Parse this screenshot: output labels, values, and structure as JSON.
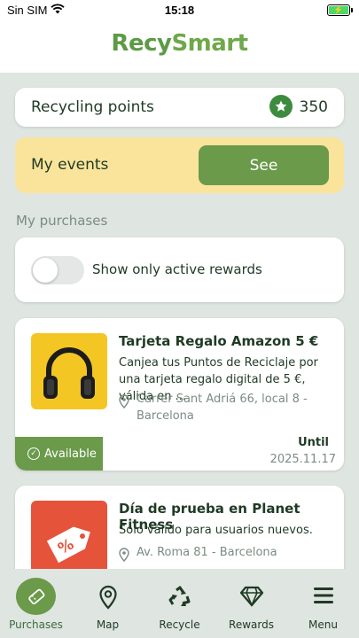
{
  "status_bar": {
    "carrier": "Sin SIM",
    "time": "15:18",
    "battery_level": 1.0
  },
  "header": {
    "logo_part1": "Recy",
    "logo_part2": "Smart"
  },
  "points": {
    "label": "Recycling points",
    "value": "350",
    "icon": "star-icon"
  },
  "events": {
    "label": "My events",
    "button_label": "See"
  },
  "purchases": {
    "section_title": "My purchases",
    "filter_label": "Show only active rewards",
    "filter_on": false,
    "items": [
      {
        "title": "Tarjeta Regalo Amazon 5 €",
        "description": "Canjea tus Puntos de Reciclaje por una tarjeta regalo digital de 5 €, válida en ...",
        "address": "Carrer Sant Adriá 66, local 8 - Barcelona",
        "status": "Available",
        "until_label": "Until",
        "until_date": "2025.11.17",
        "image_icon": "headphones-icon"
      },
      {
        "title": "Día de prueba en Planet Fitness",
        "description": "Solo válido para usuarios nuevos.",
        "address": "Av. Roma 81 - Barcelona",
        "image_icon": "discount-tag-icon"
      }
    ]
  },
  "tabs": [
    {
      "label": "Purchases",
      "icon": "ticket-icon",
      "active": true
    },
    {
      "label": "Map",
      "icon": "map-pin-icon"
    },
    {
      "label": "Recycle",
      "icon": "recycle-icon"
    },
    {
      "label": "Rewards",
      "icon": "diamond-icon"
    },
    {
      "label": "Menu",
      "icon": "menu-icon"
    }
  ],
  "colors": {
    "brand_green": "#6a9a4a",
    "events_yellow": "#fae49b",
    "background": "#dfe5e1"
  }
}
